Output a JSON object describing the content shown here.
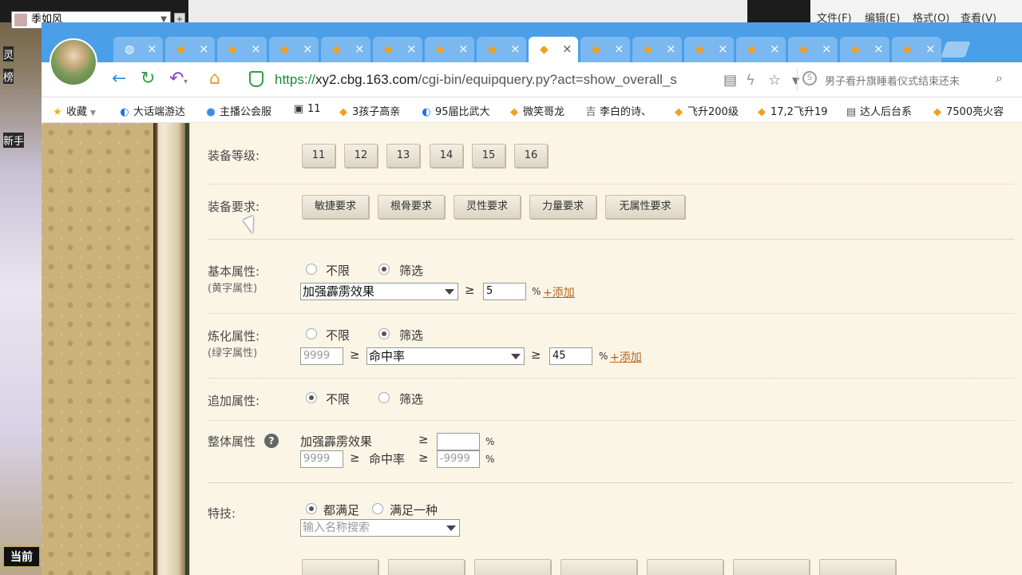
{
  "background": {
    "combo_text": "季如风",
    "notepad_menu": [
      "文件(F)",
      "编辑(E)",
      "格式(O)",
      "查看(V)"
    ],
    "side_labels": [
      "灵",
      "榜",
      "新手"
    ],
    "current_label": "当前"
  },
  "browser": {
    "tabs_count": 16,
    "url_secure": "https://",
    "url_host": "xy2.cbg.163.com",
    "url_path": "/cgi-bin/equipquery.py?act=show_overall_s",
    "search_placeholder": "男子看升旗睡着仪式结束还未",
    "bookmarks": [
      {
        "icon": "star-icon",
        "label": "收藏"
      },
      {
        "icon": "game-icon",
        "label": "大话端游达"
      },
      {
        "icon": "live-icon",
        "label": "主播公会服"
      },
      {
        "icon": "film-icon",
        "label": "11"
      },
      {
        "icon": "chicken-icon",
        "label": "3孩子高亲"
      },
      {
        "icon": "game-icon",
        "label": "95届比武大"
      },
      {
        "icon": "chicken-icon",
        "label": "微笑哥龙"
      },
      {
        "icon": "poem-icon",
        "label": "李白的诗、"
      },
      {
        "icon": "chicken-icon",
        "label": "飞升200级"
      },
      {
        "icon": "chicken-icon",
        "label": "17,2飞升19"
      },
      {
        "icon": "doc-icon",
        "label": "达人后台系"
      },
      {
        "icon": "chicken-icon",
        "label": "7500亮火容"
      }
    ]
  },
  "form": {
    "equip_level": {
      "label": "装备等级:",
      "options": [
        "11",
        "12",
        "13",
        "14",
        "15",
        "16"
      ]
    },
    "equip_req": {
      "label": "装备要求:",
      "options": [
        "敏捷要求",
        "根骨要求",
        "灵性要求",
        "力量要求",
        "无属性要求"
      ]
    },
    "basic_attr": {
      "label": "基本属性:",
      "sublabel": "(黄字属性)",
      "radio_any": "不限",
      "radio_filter": "筛选",
      "select": "加强霹雳效果",
      "op": "≥",
      "value": "5",
      "pct": "%",
      "add": "+添加"
    },
    "refine_attr": {
      "label": "炼化属性:",
      "sublabel": "(绿字属性)",
      "radio_any": "不限",
      "radio_filter": "筛选",
      "value_left": "9999",
      "op": "≥",
      "select": "命中率",
      "value": "45",
      "pct": "%",
      "add": "+添加"
    },
    "extra_attr": {
      "label": "追加属性:",
      "radio_any": "不限",
      "radio_filter": "筛选"
    },
    "overall_attr": {
      "label": "整体属性",
      "help": "?",
      "row1_name": "加强霹雳效果",
      "row1_op": "≥",
      "row1_value": "",
      "row1_pct": "%",
      "row2_left": "9999",
      "row2_op_left": "≥",
      "row2_name": "命中率",
      "row2_op": "≥",
      "row2_value": "-9999",
      "row2_pct": "%"
    },
    "skills": {
      "label": "特技:",
      "radio_all": "都满足",
      "radio_one": "满足一种",
      "search_placeholder": "输入名称搜索"
    }
  }
}
